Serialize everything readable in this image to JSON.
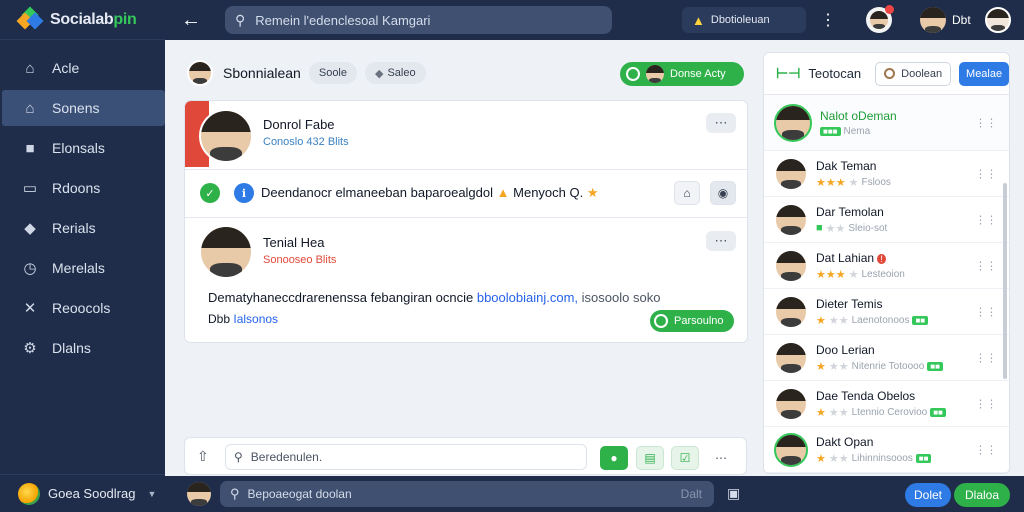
{
  "app": {
    "name_main": "Socialab",
    "name_hl": "pin"
  },
  "sidebar": {
    "items": [
      {
        "label": "Acle",
        "icon": "home-icon",
        "active": false
      },
      {
        "label": "Sonens",
        "icon": "home-icon",
        "active": true
      },
      {
        "label": "Elonsals",
        "icon": "message-icon",
        "active": false
      },
      {
        "label": "Rdoons",
        "icon": "folder-icon",
        "active": false
      },
      {
        "label": "Rerials",
        "icon": "tag-icon",
        "active": false
      },
      {
        "label": "Merelals",
        "icon": "clock-icon",
        "active": false
      },
      {
        "label": "Reoocols",
        "icon": "tools-icon",
        "active": false
      },
      {
        "label": "Dlalns",
        "icon": "settings-icon",
        "active": false
      }
    ],
    "footer_label": "Goea Soodlrag"
  },
  "topbar": {
    "search_text": "Remein l'edenclesoal Kamgari",
    "chip_label": "Dbotioleuan",
    "user_label": "Dbt"
  },
  "channel": {
    "title": "Sbonnialean",
    "pill_1": "Soole",
    "pill_2": "Saleo",
    "join_label": "Donse Acty"
  },
  "post1": {
    "name": "Donrol Fabe",
    "sub": "Conoslo 432 Blits"
  },
  "notice": {
    "text": "Deendanocr elmaneeban baparoealgdol",
    "tail": "Menyoch Q."
  },
  "post2": {
    "name": "Tenial Hea",
    "sub": "Sonooseo Blits",
    "body_prefix": "Dematyhaneccdrarenenssa febangiran ocncie",
    "body_link": "bboolobiainj.com,",
    "body_suffix": "isosoolo soko",
    "line2_prefix": "Dbb",
    "line2_link": "Ialsonos",
    "reply_label": "Parsoulno"
  },
  "composer": {
    "placeholder": "Beredenulen."
  },
  "bottombar": {
    "search_text": "Bepoaeogat doolan",
    "ghost_label": "Dalt",
    "btn_blue": "Dolet",
    "btn_green": "Dlaloa"
  },
  "members_panel": {
    "title": "Teotocan",
    "outline_btn": "Doolean",
    "blue_btn": "Mealae",
    "members": [
      {
        "name": "Nalot oDeman",
        "meta": "Nema",
        "stars": 0,
        "status": "online"
      },
      {
        "name": "Dak Teman",
        "meta": "Fsloos",
        "stars": 3,
        "status": "none"
      },
      {
        "name": "Dar Temolan",
        "meta": "Sleio-sot",
        "stars": 1,
        "status": "none"
      },
      {
        "name": "Dat Lahian",
        "meta": "Lesteoion",
        "stars": 3,
        "status": "alert"
      },
      {
        "name": "Dieter Temis",
        "meta": "Laenotonoos",
        "stars": 1,
        "status": "none"
      },
      {
        "name": "Doo Lerian",
        "meta": "Nitenrie Totoooo",
        "stars": 1,
        "status": "none"
      },
      {
        "name": "Dae Tenda Obelos",
        "meta": "Ltennio Cerovioo",
        "stars": 1,
        "status": "none"
      },
      {
        "name": "Dakt Opan",
        "meta": "Lihinninsooos",
        "stars": 1,
        "status": "online"
      }
    ]
  },
  "colors": {
    "sidebar": "#1f2d4a",
    "accent_green": "#2fb14a",
    "accent_blue": "#2e7be6",
    "alert_red": "#e0493a"
  }
}
